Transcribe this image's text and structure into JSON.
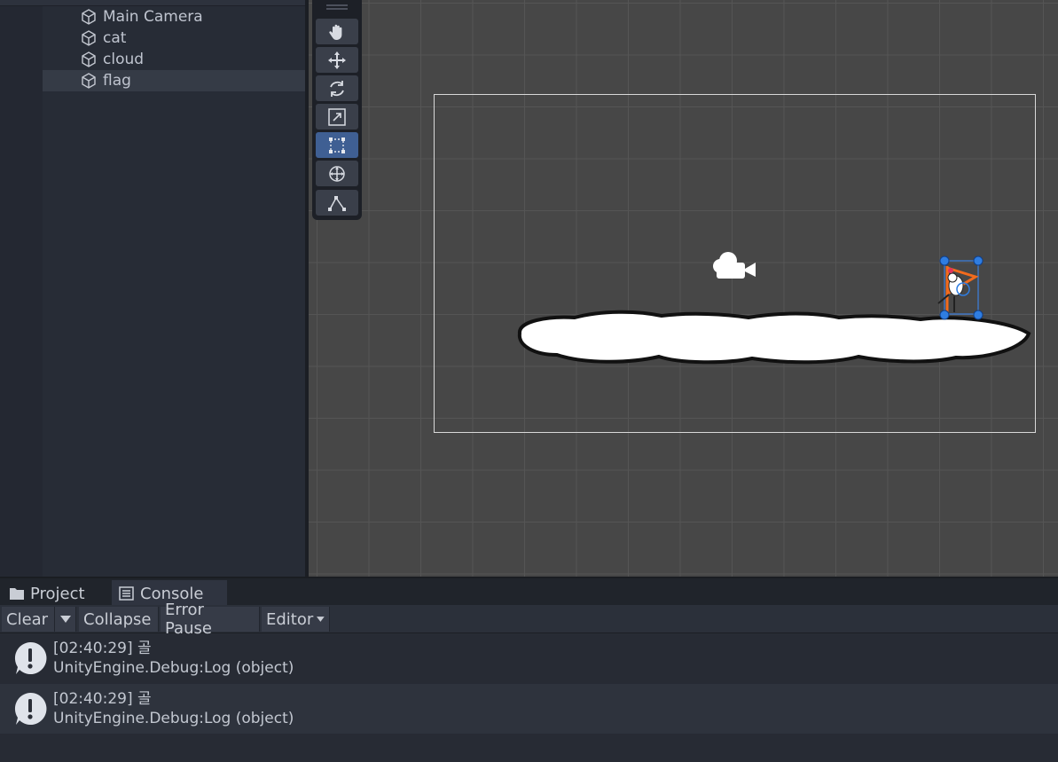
{
  "hierarchy": {
    "items": [
      {
        "label": "Main Camera",
        "selected": false
      },
      {
        "label": "cat",
        "selected": false
      },
      {
        "label": "cloud",
        "selected": false
      },
      {
        "label": "flag",
        "selected": true
      }
    ]
  },
  "scene": {
    "tools": [
      "hand-tool",
      "move-tool",
      "rotate-tool",
      "scale-tool",
      "rect-tool",
      "transform-tool",
      "custom-tool"
    ],
    "active_tool": "rect-tool",
    "objects": [
      "camera-gizmo",
      "cloud-sprite",
      "cat-sprite",
      "flag-sprite"
    ]
  },
  "bottom": {
    "tabs": {
      "project": "Project",
      "console": "Console"
    },
    "toolbar": {
      "clear": "Clear",
      "collapse": "Collapse",
      "error_pause": "Error Pause",
      "editor": "Editor"
    },
    "logs": [
      {
        "time": "[02:40:29] 골",
        "trace": "UnityEngine.Debug:Log (object)"
      },
      {
        "time": "[02:40:29] 골",
        "trace": "UnityEngine.Debug:Log (object)"
      }
    ]
  },
  "colors": {
    "scene_bg": "#474747",
    "selection_blue": "#3f5f93",
    "handle_blue": "#2f7de1",
    "flag_orange": "#f26b1d"
  }
}
